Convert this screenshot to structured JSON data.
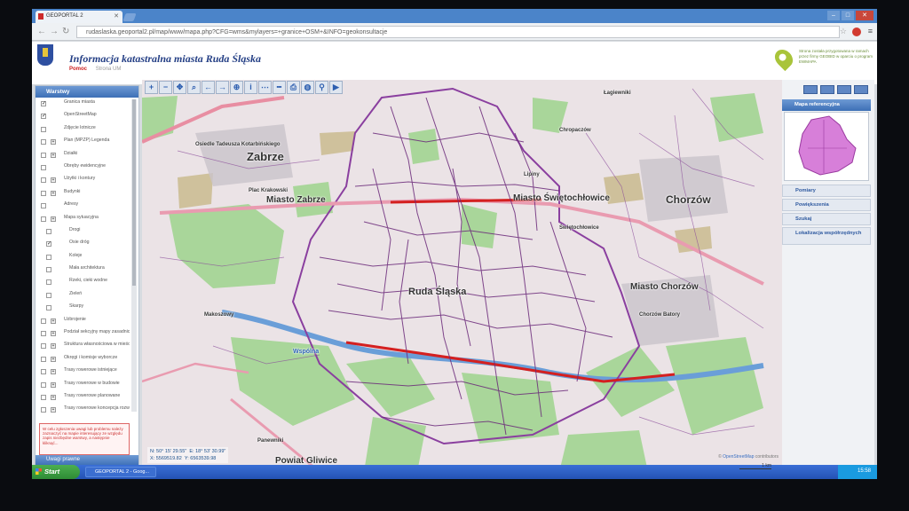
{
  "browser": {
    "tab_title": "GEOPORTAL 2",
    "url": "rudaslaska.geoportal2.pl/map/www/mapa.php?CFG=wms&mylayers=+granice+OSM+&INFO=geokonsultacje"
  },
  "header": {
    "title": "Informacja katastralna miasta Ruda Śląska",
    "help_link": "Pomoc",
    "city_link": "Strona UM",
    "note": "Strona została przygotowana w ramach przez firmy GEOBID w oparciu o program EWMAPA"
  },
  "left_panel": {
    "heading": "Warstwy",
    "layers": [
      {
        "label": "Granica miasta",
        "checked": true,
        "expandable": false,
        "indent": false
      },
      {
        "label": "OpenStreetMap",
        "checked": true,
        "expandable": false,
        "indent": false
      },
      {
        "label": "Zdjęcie lotnicze",
        "checked": false,
        "expandable": false,
        "indent": false
      },
      {
        "label": "Plan (MPZP) Legenda",
        "checked": false,
        "expandable": true,
        "indent": false
      },
      {
        "label": "Działki",
        "checked": false,
        "expandable": true,
        "indent": false
      },
      {
        "label": "Obręby ewidencyjne",
        "checked": false,
        "expandable": false,
        "indent": false
      },
      {
        "label": "Użytki i kontury",
        "checked": false,
        "expandable": true,
        "indent": false
      },
      {
        "label": "Budynki",
        "checked": false,
        "expandable": true,
        "indent": false
      },
      {
        "label": "Adresy",
        "checked": false,
        "expandable": false,
        "indent": false
      },
      {
        "label": "Mapa sytuacyjna",
        "checked": false,
        "expandable": true,
        "indent": false
      },
      {
        "label": "Drogi",
        "checked": false,
        "expandable": false,
        "indent": true
      },
      {
        "label": "Osie dróg",
        "checked": true,
        "expandable": false,
        "indent": true
      },
      {
        "label": "Koleje",
        "checked": false,
        "expandable": false,
        "indent": true
      },
      {
        "label": "Mała architektura",
        "checked": false,
        "expandable": false,
        "indent": true
      },
      {
        "label": "Rzeki, cieki wodne",
        "checked": false,
        "expandable": false,
        "indent": true
      },
      {
        "label": "Zieleń",
        "checked": false,
        "expandable": false,
        "indent": true
      },
      {
        "label": "Skarpy",
        "checked": false,
        "expandable": false,
        "indent": true
      },
      {
        "label": "Uzbrojenie",
        "checked": false,
        "expandable": true,
        "indent": false
      },
      {
        "label": "Podział sekcyjny mapy zasadniczej",
        "checked": false,
        "expandable": true,
        "indent": false
      },
      {
        "label": "Struktura własnościowa w mieście",
        "checked": false,
        "expandable": true,
        "indent": false
      },
      {
        "label": "Okręgi i komisje wyborcze",
        "checked": false,
        "expandable": true,
        "indent": false
      },
      {
        "label": "Trasy rowerowe istniejące",
        "checked": false,
        "expandable": true,
        "indent": false
      },
      {
        "label": "Trasy rowerowe w budowie",
        "checked": false,
        "expandable": true,
        "indent": false
      },
      {
        "label": "Trasy rowerowe planowane",
        "checked": false,
        "expandable": true,
        "indent": false
      },
      {
        "label": "Trasy rowerowe koncepcja rozwoju",
        "checked": false,
        "expandable": true,
        "indent": false
      }
    ],
    "notice": "W celu zgłoszenia uwagi lub problemu należy zaznaczyć na mapie interesujący ze względu zapis niezbędne warstwy, a następnie kliknąć...",
    "footer": "Uwagi prawne"
  },
  "map": {
    "labels": [
      {
        "text": "Zabrze",
        "size": 13
      },
      {
        "text": "Miasto Zabrze",
        "size": 10
      },
      {
        "text": "Miasto Świętochłowice",
        "size": 10
      },
      {
        "text": "Chorzów",
        "size": 12
      },
      {
        "text": "Ruda Śląska",
        "size": 11
      },
      {
        "text": "Miasto Chorzów",
        "size": 10
      },
      {
        "text": "Powiat Gliwice",
        "size": 10
      },
      {
        "text": "Wspólna",
        "size": 7
      },
      {
        "text": "Osiedle Tadeusza Kotarbińskiego",
        "size": 6
      },
      {
        "text": "Plac Krakowski",
        "size": 6
      },
      {
        "text": "Świętochłowice",
        "size": 6
      },
      {
        "text": "Chorzów Batory",
        "size": 6
      },
      {
        "text": "Makoszowy",
        "size": 6
      },
      {
        "text": "Panewniki",
        "size": 6
      },
      {
        "text": "Lipiny",
        "size": 6
      },
      {
        "text": "Chropaczów",
        "size": 6
      },
      {
        "text": "Łagiewniki",
        "size": 6
      }
    ],
    "coords": {
      "lon": "N: 50° 15' 29.55\"",
      "lat": "E: 18° 53' 30.99\"",
      "x": "X: 5569519.82",
      "y": "Y: 6563539.98"
    },
    "attribution_prefix": "©",
    "attribution_link": "OpenStreetMap",
    "attribution_suffix": "contributors",
    "scale": "1 km"
  },
  "right_panel": {
    "ref_heading": "Mapa referencyjna",
    "sections": [
      "Pomiary",
      "Powiększenia",
      "Szukaj",
      "Lokalizacja współrzędnych"
    ]
  },
  "taskbar": {
    "start": "Start",
    "item": "GEOPORTAL 2 - Goog...",
    "clock": "15:58"
  }
}
